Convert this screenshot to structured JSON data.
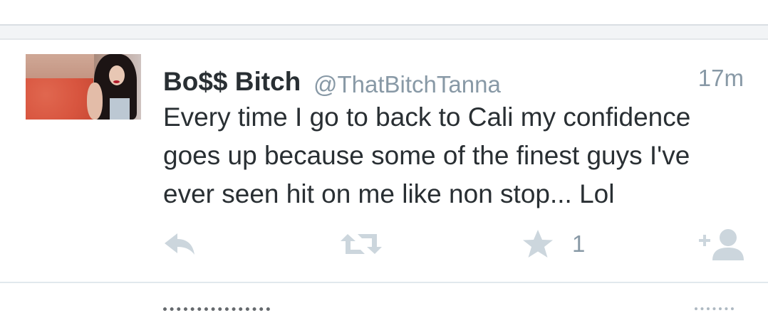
{
  "tweet": {
    "display_name": "Bo$$ Bitch",
    "handle": "@ThatBitchTanna",
    "timestamp": "17m",
    "text": "Every time I go to back to Cali my confidence goes up because some of the finest guys I've ever seen hit on me like non stop... Lol",
    "favorite_count": "1"
  },
  "actions": {
    "reply_icon": "reply-icon",
    "retweet_icon": "retweet-icon",
    "favorite_icon": "star-icon",
    "follow_icon": "follow-user-icon"
  },
  "colors": {
    "text": "#292f33",
    "muted": "#8899a6",
    "icon": "#ccd6dd",
    "divider": "#e1e8ed",
    "band": "#f2f4f6"
  }
}
